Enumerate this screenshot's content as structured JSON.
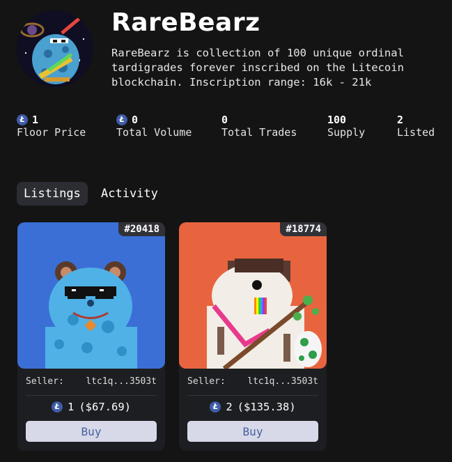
{
  "collection": {
    "name": "RareBearz",
    "description": "RareBearz is collection of 100 unique ordinal tardigrades forever inscribed on the Litecoin blockchain. Inscription range: 16k - 21k"
  },
  "currency_symbol": "Ł",
  "stats": [
    {
      "value": "1",
      "label": "Floor Price",
      "has_icon": true
    },
    {
      "value": "0",
      "label": "Total Volume",
      "has_icon": true
    },
    {
      "value": "0",
      "label": "Total Trades",
      "has_icon": false
    },
    {
      "value": "100",
      "label": "Supply",
      "has_icon": false
    },
    {
      "value": "2",
      "label": "Listed",
      "has_icon": false
    }
  ],
  "tabs": [
    {
      "label": "Listings",
      "active": true
    },
    {
      "label": "Activity",
      "active": false
    }
  ],
  "listings": [
    {
      "inscription": "#20418",
      "seller_label": "Seller:",
      "seller": "ltc1q...3503t",
      "price": "1",
      "usd": "($67.69)",
      "buy_label": "Buy",
      "bg": "#3b6fd6"
    },
    {
      "inscription": "#18774",
      "seller_label": "Seller:",
      "seller": "ltc1q...3503t",
      "price": "2",
      "usd": "($135.38)",
      "buy_label": "Buy",
      "bg": "#e8643f"
    }
  ],
  "colors": {
    "background": "#141414",
    "card": "#1d1e22",
    "accent": "#3e5ca8",
    "button": "#d7d9e8"
  }
}
